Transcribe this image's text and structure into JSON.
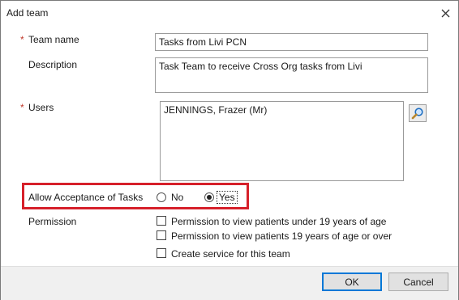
{
  "window": {
    "title": "Add team"
  },
  "form": {
    "required_marker": "*",
    "team_name": {
      "label": "Team name",
      "value": "Tasks from Livi PCN"
    },
    "description": {
      "label": "Description",
      "value": "Task Team to receive Cross Org tasks from Livi"
    },
    "users": {
      "label": "Users",
      "value": "JENNINGS, Frazer (Mr)"
    },
    "acceptance": {
      "label": "Allow Acceptance of Tasks",
      "no_label": "No",
      "yes_label": "Yes",
      "selected": "Yes",
      "highlight_color": "#d6202a"
    },
    "permission": {
      "label": "Permission",
      "under_19": "Permission to view patients under 19 years of age",
      "over_19": "Permission to view patients 19 years of age or over"
    },
    "create_service": "Create service for this team"
  },
  "buttons": {
    "ok": "OK",
    "cancel": "Cancel"
  },
  "icons": {
    "close": "close-icon",
    "search": "magnifier-icon"
  }
}
